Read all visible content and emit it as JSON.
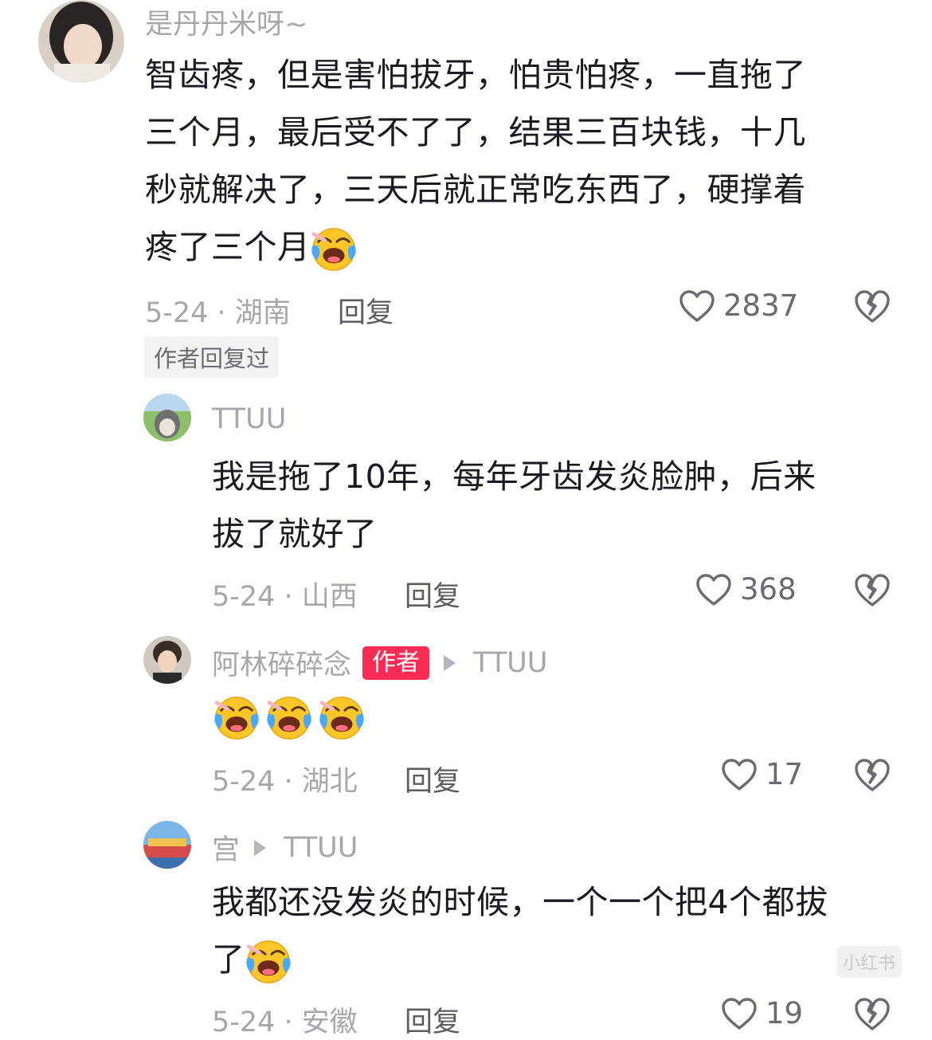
{
  "comments": [
    {
      "user": "是丹丹米呀~",
      "lines": [
        "智齿疼，但是害怕拔牙，怕贵怕疼，一直拖了",
        "三个月，最后受不了了，结果三百块钱，十几",
        "秒就解决了，三天后就正常吃东西了，硬撑着",
        "疼了三个月"
      ],
      "emoji": "laugh-cry",
      "date_location": "5-24 · 湖南",
      "reply_label": "回复",
      "likes": "2837",
      "author_replied_chip": "作者回复过"
    },
    {
      "user": "TTUU",
      "lines": [
        "我是拖了10年，每年牙齿发炎脸肿，后来",
        "拔了就好了"
      ],
      "date_location": "5-24 · 山西",
      "reply_label": "回复",
      "likes": "368"
    },
    {
      "user": "阿林碎碎念",
      "author_badge": "作者",
      "reply_to": "TTUU",
      "emoji_count": 3,
      "date_location": "5-24 · 湖北",
      "reply_label": "回复",
      "likes": "17"
    },
    {
      "user": "宫",
      "reply_to": "TTUU",
      "lines": [
        "我都还没发炎的时候，一个一个把4个都拔",
        "了"
      ],
      "date_location": "5-24 · 安徽",
      "reply_label": "回复",
      "likes": "19"
    }
  ],
  "watermark": "小红书",
  "colors": {
    "accent": "#fe2c55",
    "meta": "#a6a7ac",
    "text": "#1a1b22"
  },
  "icons": [
    "heart-icon",
    "broken-heart-icon",
    "laugh-cry-emoji",
    "arrow-right-icon"
  ]
}
